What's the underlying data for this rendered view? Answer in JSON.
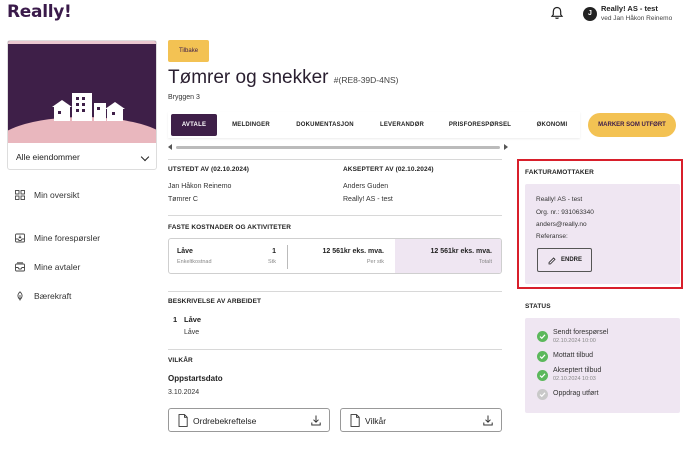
{
  "header": {
    "logo": "Really!",
    "user_initial": "J",
    "user_name": "Really! AS - test",
    "user_sub": "ved Jan Håkon Reinemo"
  },
  "sidebar": {
    "property_select": "Alle eiendommer",
    "nav": [
      {
        "label": "Min oversikt",
        "icon": "grid-icon"
      },
      {
        "label": "Mine forespørsler",
        "icon": "inbox-icon"
      },
      {
        "label": "Mine avtaler",
        "icon": "contract-icon"
      },
      {
        "label": "Bærekraft",
        "icon": "leaf-icon"
      }
    ]
  },
  "main": {
    "back_label": "Tilbake",
    "title": "Tømrer og snekker",
    "title_id": "#(RE8-39D-4NS)",
    "address": "Bryggen 3",
    "tabs": [
      "AVTALE",
      "MELDINGER",
      "DOKUMENTASJON",
      "LEVERANDØR",
      "PRISFORESPØRSEL",
      "ØKONOMI"
    ],
    "mark_done_label": "MARKER SOM UTFØRT",
    "issued": {
      "label": "UTSTEDT AV (02.10.2024)",
      "name": "Jan Håkon Reinemo",
      "company": "Tømrer C"
    },
    "accepted": {
      "label": "AKSEPTERT AV (02.10.2024)",
      "name": "Anders Guden",
      "company": "Really! AS - test"
    },
    "costs": {
      "label": "FASTE KOSTNADER OG AKTIVITETER",
      "item": "Låve",
      "item_sub": "Enkeltkostnad",
      "qty": "1",
      "qty_unit": "Stk",
      "unit_price": "12 561kr eks. mva.",
      "unit_price_sub": "Per stk",
      "total": "12 561kr eks. mva.",
      "total_sub": "Totalt"
    },
    "description": {
      "label": "BESKRIVELSE AV ARBEIDET",
      "num": "1",
      "title": "Låve",
      "text": "Låve"
    },
    "terms": {
      "label": "VILKÅR",
      "start_label": "Oppstartsdato",
      "start_date": "3.10.2024"
    },
    "files": [
      {
        "label": "Ordrebekreftelse"
      },
      {
        "label": "Vilkår"
      }
    ]
  },
  "invoice": {
    "title": "FAKTURAMOTTAKER",
    "company": "Really! AS - test",
    "org": "Org. nr.: 931063340",
    "email": "anders@really.no",
    "reference": "Referanse:",
    "edit_label": "ENDRE"
  },
  "status": {
    "title": "STATUS",
    "items": [
      {
        "label": "Sendt forespørsel",
        "date": "02.10.2024 10:00",
        "done": true
      },
      {
        "label": "Mottatt tilbud",
        "date": "",
        "done": true
      },
      {
        "label": "Akseptert tilbud",
        "date": "02.10.2024 10:03",
        "done": true
      },
      {
        "label": "Oppdrag utført",
        "date": "",
        "done": false
      }
    ]
  },
  "colors": {
    "brand_purple": "#3e1f48",
    "accent_yellow": "#f3c253",
    "light_purple": "#efe6f2",
    "highlight_red": "#d81f2b",
    "status_green": "#5cb85c"
  }
}
